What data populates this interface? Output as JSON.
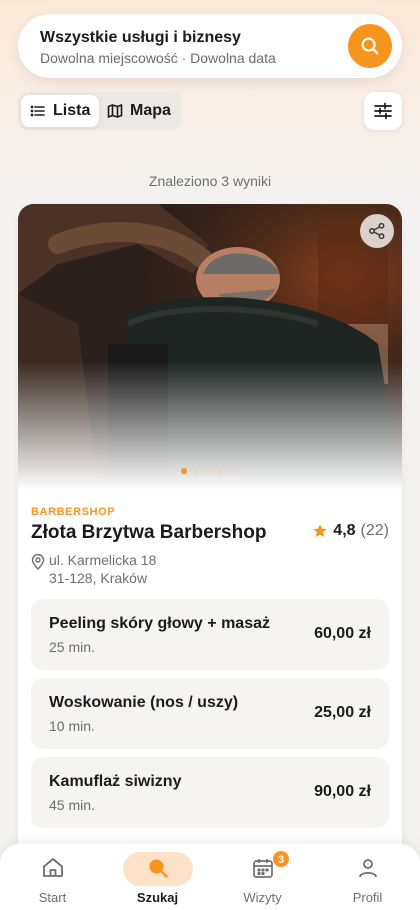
{
  "search": {
    "title": "Wszystkie usługi i biznesy",
    "subtitle": "Dowolna miejscowość · Dowolna data"
  },
  "view_toggle": {
    "list_label": "Lista",
    "map_label": "Mapa",
    "active": "Lista"
  },
  "results": {
    "count_text": "Znaleziono 3 wyniki"
  },
  "business": {
    "category": "BARBERSHOP",
    "name": "Złota Brzytwa Barbershop",
    "rating": "4,8",
    "reviews": "(22)",
    "address_line1": "ul. Karmelicka 18",
    "address_line2": "31-128, Kraków",
    "photo_count": 5,
    "active_photo": 1
  },
  "services": [
    {
      "name": "Peeling skóry głowy + masaż",
      "duration": "25 min.",
      "price": "60,00 zł"
    },
    {
      "name": "Woskowanie (nos / uszy)",
      "duration": "10 min.",
      "price": "25,00 zł"
    },
    {
      "name": "Kamuflaż siwizny",
      "duration": "45 min.",
      "price": "90,00 zł"
    }
  ],
  "nav": {
    "items": [
      {
        "label": "Start",
        "icon": "home-icon"
      },
      {
        "label": "Szukaj",
        "icon": "search-icon"
      },
      {
        "label": "Wizyty",
        "icon": "calendar-icon",
        "badge": "3"
      },
      {
        "label": "Profil",
        "icon": "user-icon"
      }
    ],
    "active": "Szukaj"
  },
  "colors": {
    "accent": "#f7941d",
    "accent_soft": "#fde2c8",
    "text": "#1b1b1b",
    "muted": "#6e6e6e"
  }
}
